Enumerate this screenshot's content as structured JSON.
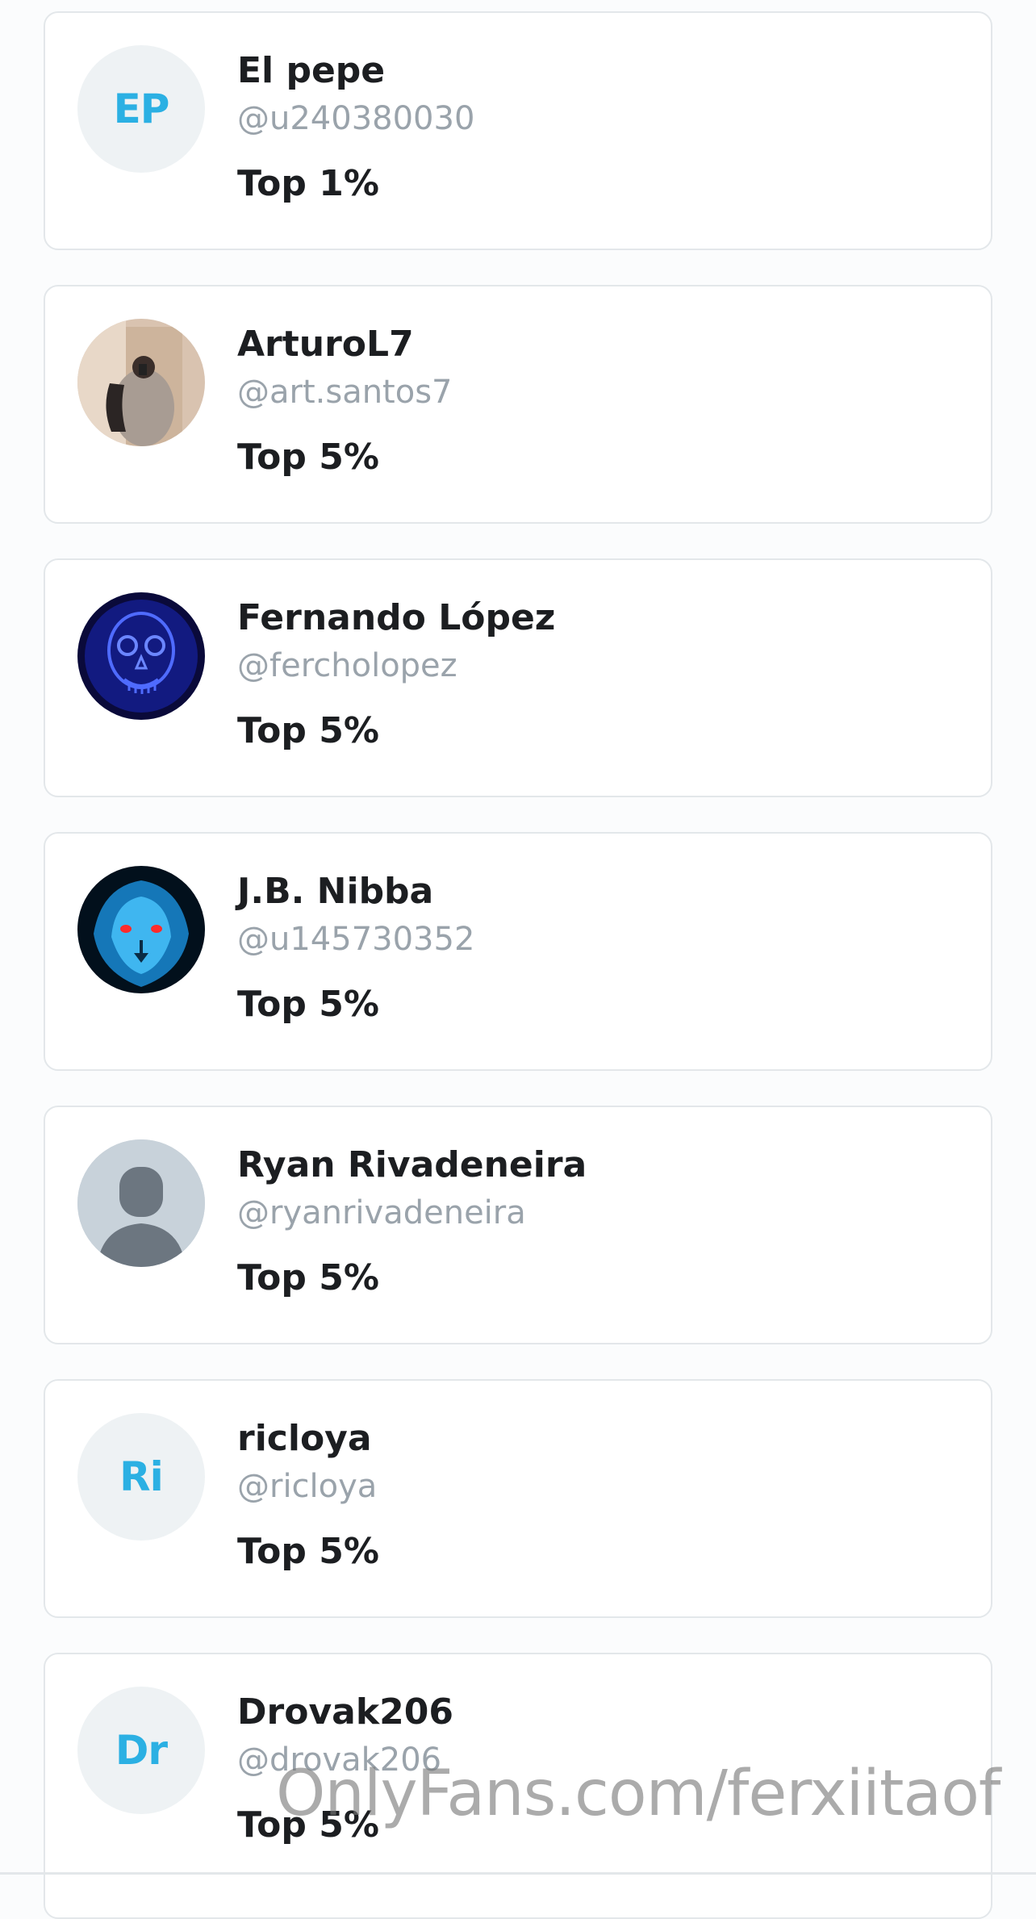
{
  "users": [
    {
      "display_name": "El pepe",
      "handle": "@u240380030",
      "rank": "Top 1%",
      "initials": "EP",
      "avatar": "initials"
    },
    {
      "display_name": "ArturoL7",
      "handle": "@art.santos7",
      "rank": "Top 5%",
      "avatar": "photo-mirror-selfie"
    },
    {
      "display_name": "Fernando López",
      "handle": "@fercholopez",
      "rank": "Top 5%",
      "avatar": "neon-skull-image"
    },
    {
      "display_name": "J.B. Nibba",
      "handle": "@u145730352",
      "rank": "Top 5%",
      "avatar": "blue-lion-image"
    },
    {
      "display_name": "Ryan Rivadeneira",
      "handle": "@ryanrivadeneira",
      "rank": "Top 5%",
      "avatar": "default-person-icon"
    },
    {
      "display_name": "ricloya",
      "handle": "@ricloya",
      "rank": "Top 5%",
      "initials": "Ri",
      "avatar": "initials"
    },
    {
      "display_name": "Drovak206",
      "handle": "@drovak206",
      "rank": "Top 5%",
      "initials": "Dr",
      "avatar": "initials"
    }
  ],
  "watermark": "OnlyFans.com/ferxiitaof",
  "colors": {
    "initials_text": "#2bb0e3",
    "avatar_bg": "#eef2f4",
    "handle_text": "#9aa3ab",
    "card_border": "#e3e7ea"
  }
}
